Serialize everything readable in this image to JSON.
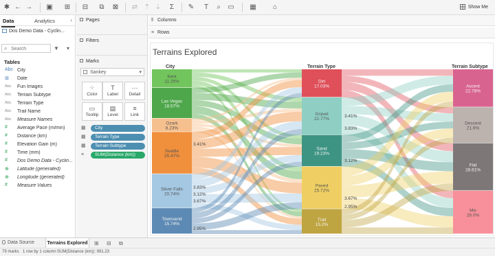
{
  "toolbar": {
    "show_me_label": "Show Me"
  },
  "data_pane": {
    "tab_data": "Data",
    "tab_analytics": "Analytics",
    "collapse_glyph": "‹",
    "datasource_name": "Dos Demo Data - Cyclin...",
    "search_placeholder": "Search",
    "tables_heading": "Tables",
    "fields": [
      {
        "type_label": "Abc",
        "name": "City",
        "kind": "dim"
      },
      {
        "type_label": "⊞",
        "name": "Date",
        "kind": "dim"
      },
      {
        "type_label": "Abc",
        "name": "Fun Images",
        "kind": "text"
      },
      {
        "type_label": "Abc",
        "name": "Terrain Subtype",
        "kind": "text"
      },
      {
        "type_label": "Abc",
        "name": "Terrain Type",
        "kind": "text"
      },
      {
        "type_label": "Abc",
        "name": "Trail Name",
        "kind": "text"
      },
      {
        "type_label": "Abc",
        "name": "Measure Names",
        "kind": "text",
        "italic": true
      },
      {
        "type_label": "#",
        "name": "Average Pace (m/min)",
        "kind": "measure"
      },
      {
        "type_label": "#",
        "name": "Distance (km)",
        "kind": "measure"
      },
      {
        "type_label": "#",
        "name": "Elevation Gain (m)",
        "kind": "measure"
      },
      {
        "type_label": "#",
        "name": "Time (mm)",
        "kind": "measure"
      },
      {
        "type_label": "#",
        "name": "Dos Demo Data - Cyclin...",
        "kind": "measure",
        "italic": true
      },
      {
        "type_label": "⊕",
        "name": "Latitude (generated)",
        "kind": "measure",
        "italic": true
      },
      {
        "type_label": "⊕",
        "name": "Longitude (generated)",
        "kind": "measure",
        "italic": true
      },
      {
        "type_label": "#",
        "name": "Measure Values",
        "kind": "measure",
        "italic": true
      }
    ]
  },
  "cards": {
    "pages_title": "Pages",
    "filters_title": "Filters",
    "marks_title": "Marks",
    "marks_type": "Sankey",
    "buttons": [
      {
        "label": "Color",
        "icon": "⁘"
      },
      {
        "label": "Label",
        "icon": "T"
      },
      {
        "label": "Detail",
        "icon": "⋯"
      },
      {
        "label": "Tooltip",
        "icon": "▭"
      },
      {
        "label": "Level",
        "icon": "▤"
      },
      {
        "label": "Link",
        "icon": "≡"
      }
    ],
    "pills": [
      {
        "label": "City",
        "kind": "dim"
      },
      {
        "label": "Terrain Type",
        "kind": "dim"
      },
      {
        "label": "Terrain Subtype",
        "kind": "dim"
      },
      {
        "label": "SUM(Distance (km))",
        "kind": "meas"
      }
    ]
  },
  "shelves": {
    "columns_label": "Columns",
    "rows_label": "Rows"
  },
  "view": {
    "title": "Terrains Explored",
    "col_city": "City",
    "col_type": "Terrain Type",
    "col_subtype": "Terrain Subtype"
  },
  "chart_data": {
    "type": "sankey",
    "title": "Terrains Explored",
    "levels": [
      "City",
      "Terrain Type",
      "Terrain Subtype"
    ],
    "nodes": {
      "City": [
        {
          "name": "Kent",
          "pct": "11.25%",
          "color": "#72c45c"
        },
        {
          "name": "Las Vegas",
          "pct": "18.57%",
          "color": "#4ea74a"
        },
        {
          "name": "Ozark",
          "pct": "8.23%",
          "color": "#f6c08e"
        },
        {
          "name": "Seattle",
          "pct": "25.47%",
          "color": "#f08f3c"
        },
        {
          "name": "Silver Falls",
          "pct": "20.74%",
          "color": "#a5c8e2"
        },
        {
          "name": "Townsend",
          "pct": "15.74%",
          "color": "#5d8ab4"
        }
      ],
      "Terrain Type": [
        {
          "name": "Dirt",
          "pct": "17.03%",
          "color": "#e0505a"
        },
        {
          "name": "Gravel",
          "pct": "22.77%",
          "color": "#8fcfc3"
        },
        {
          "name": "Sand",
          "pct": "19.23%",
          "color": "#3e9483"
        },
        {
          "name": "Paved",
          "pct": "25.72%",
          "color": "#efcf63"
        },
        {
          "name": "Trail",
          "pct": "15.2%",
          "color": "#bfa542"
        }
      ],
      "Terrain Subtype": [
        {
          "name": "Ascent",
          "pct": "22.78%",
          "color": "#d9638f"
        },
        {
          "name": "Descent",
          "pct": "21.6%",
          "color": "#bcb2ae"
        },
        {
          "name": "Flat",
          "pct": "28.61%",
          "color": "#7e7778"
        },
        {
          "name": "Mix",
          "pct": "26.0%",
          "color": "#f7909a"
        }
      ]
    },
    "flow_labels": [
      "3.41%",
      "3.83%",
      "3.12%",
      "3.67%",
      "2.95%",
      "3.41%",
      "3.83%",
      "3.12%",
      "3.67%",
      "2.95%"
    ]
  },
  "sheet_tabs": {
    "datasource_tab": "Data Source",
    "active_sheet": "Terrains Explored"
  },
  "status": {
    "marks": "79 marks",
    "rows_cols": "1 row by 1 column",
    "sum": "SUM(Distance (km)): 991.23"
  }
}
